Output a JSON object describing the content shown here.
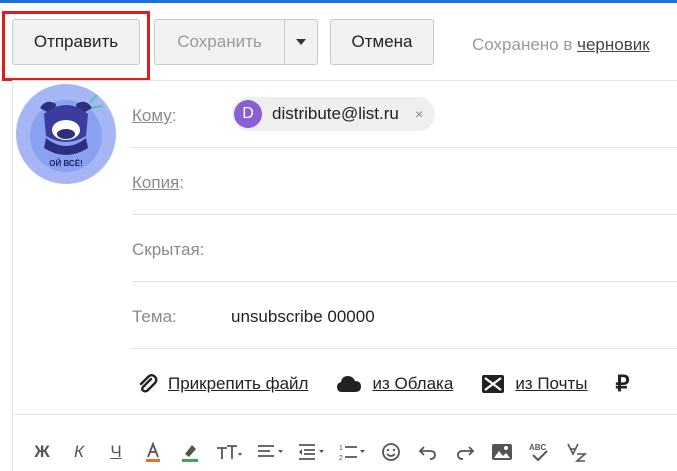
{
  "toolbar": {
    "send_label": "Отправить",
    "save_label": "Сохранить",
    "save_menu_icon": "caret-down-icon",
    "cancel_label": "Отмена",
    "saved_prefix": "Сохранено в ",
    "saved_link": "черновик"
  },
  "avatar": {
    "caption": "ОЙ ВСЁ!"
  },
  "compose": {
    "to_label": "Кому",
    "to_suffix": ":",
    "recipient_initial": "D",
    "recipient_email": "distribute@list.ru",
    "recipient_remove": "×",
    "cc_label": "Копия",
    "cc_suffix": ":",
    "bcc_label": "Скрытая:",
    "subject_label": "Тема:",
    "subject_value": "unsubscribe 00000"
  },
  "attachments": {
    "file_label": "Прикрепить файл",
    "cloud_label": "из Облака",
    "mail_label": "из Почты"
  },
  "format_bar": {
    "bold": "Ж",
    "italic": "К",
    "underline": "Ч"
  },
  "colors": {
    "accent_topline": "#1d6fe0",
    "highlight_outline": "#e01c1c",
    "chip_avatar": "#8a5fd1"
  }
}
